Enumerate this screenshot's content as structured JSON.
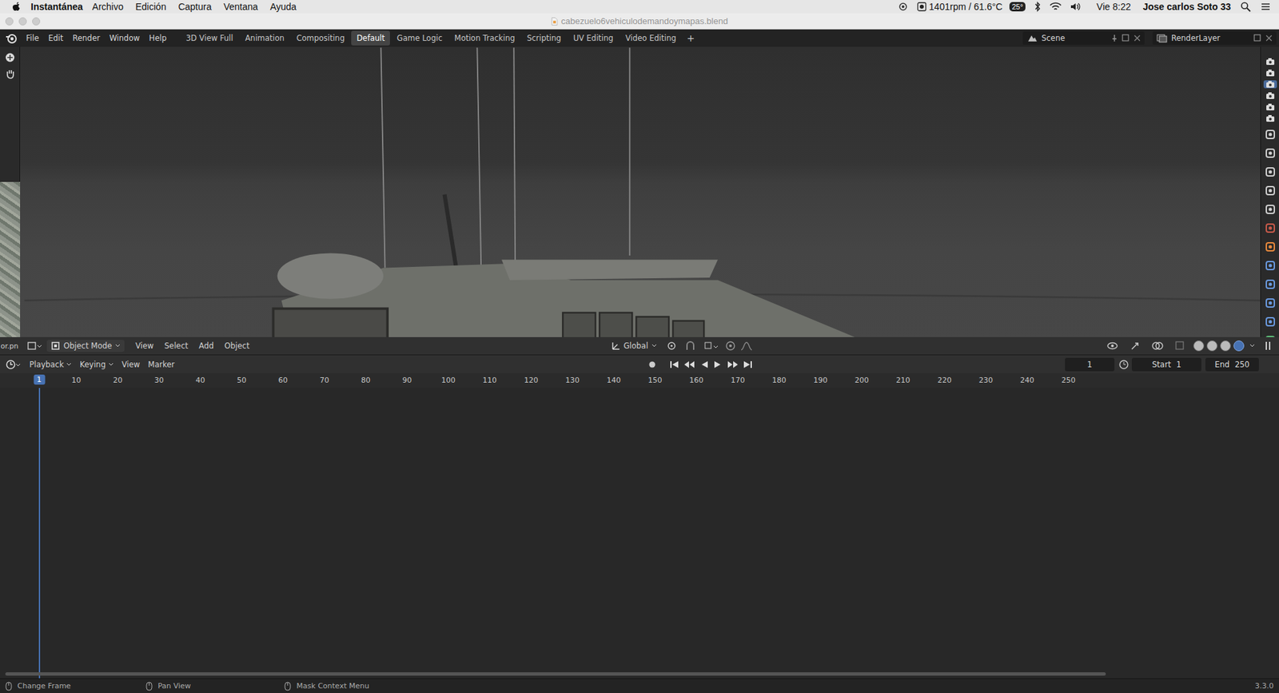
{
  "menubar": {
    "app": "Instantánea",
    "menus": [
      "Archivo",
      "Edición",
      "Captura",
      "Ventana",
      "Ayuda"
    ],
    "fan": "1401rpm / 61.6°C",
    "temperature": "25°",
    "clock": "Vie 8:22",
    "user": "Jose carlos Soto 33"
  },
  "window": {
    "title": "cabezuelo6vehiculodemandoymapas.blend"
  },
  "topbar": {
    "menus": [
      "File",
      "Edit",
      "Render",
      "Window",
      "Help"
    ],
    "workspaces": [
      {
        "label": "3D View Full",
        "selected": false
      },
      {
        "label": "Animation",
        "selected": false
      },
      {
        "label": "Compositing",
        "selected": false
      },
      {
        "label": "Default",
        "selected": true
      },
      {
        "label": "Game Logic",
        "selected": false
      },
      {
        "label": "Motion Tracking",
        "selected": false
      },
      {
        "label": "Scripting",
        "selected": false
      },
      {
        "label": "UV Editing",
        "selected": false
      },
      {
        "label": "Video Editing",
        "selected": false
      }
    ],
    "add_workspace": "+",
    "scene": "Scene",
    "view_layer": "RenderLayer"
  },
  "render_slots": [
    {
      "selected": false
    },
    {
      "selected": false
    },
    {
      "selected": true
    },
    {
      "selected": false
    },
    {
      "selected": false
    },
    {
      "selected": false
    }
  ],
  "viewport_header": {
    "image_name": "or.pn",
    "mode": "Object Mode",
    "menus": [
      "View",
      "Select",
      "Add",
      "Object"
    ],
    "orientation": "Global",
    "shading": [
      {
        "selected": false
      },
      {
        "selected": false
      },
      {
        "selected": false
      },
      {
        "selected": true
      }
    ]
  },
  "timeline": {
    "menus": [
      "Playback",
      "Keying",
      "View",
      "Marker"
    ],
    "current_frame": "1",
    "start_label": "Start",
    "start": "1",
    "end_label": "End",
    "end": "250",
    "playhead": "1",
    "ruler": [
      "10",
      "20",
      "30",
      "40",
      "50",
      "60",
      "70",
      "80",
      "90",
      "100",
      "110",
      "120",
      "130",
      "140",
      "150",
      "160",
      "170",
      "180",
      "190",
      "200",
      "210",
      "220",
      "230",
      "240",
      "250"
    ]
  },
  "status_bar": {
    "hints": [
      "Change Frame",
      "Pan View",
      "Mask Context Menu"
    ],
    "version": "3.3.0"
  }
}
